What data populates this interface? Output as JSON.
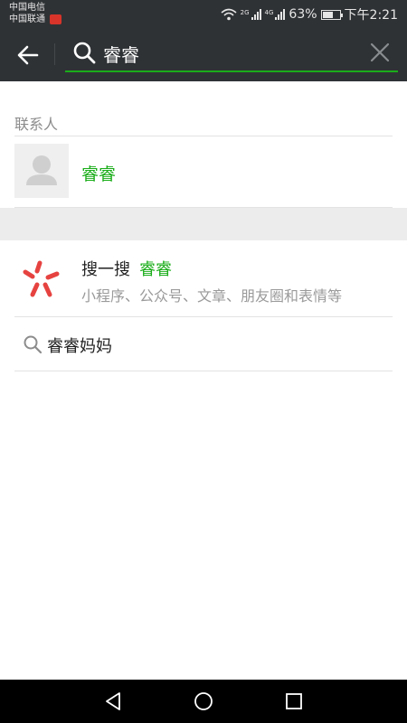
{
  "status_bar": {
    "carrier_1": "中国电信",
    "carrier_2": "中国联通",
    "carrier_badge_text": "头条",
    "signal_1_tag": "2G",
    "signal_2_tag": "4G",
    "battery_percent": "63%",
    "battery_level": 0.63,
    "time": "下午2:21"
  },
  "top_bar": {
    "back_icon": "arrow-left-icon",
    "search_icon": "search-icon",
    "search_query": "睿睿",
    "clear_icon": "close-icon"
  },
  "contacts_section": {
    "header": "联系人",
    "items": [
      {
        "name": "睿睿",
        "avatar": "default-person-avatar"
      }
    ]
  },
  "search_one_search": {
    "title": "搜一搜",
    "keyword": "睿睿",
    "description": "小程序、公众号、文章、朋友圈和表情等",
    "icon": "sousuo-logo-icon",
    "accent_color": "#e64340"
  },
  "suggestions": [
    {
      "text": "睿睿妈妈",
      "icon": "search-icon"
    }
  ],
  "nav_bar": {
    "back": "triangle-back-icon",
    "home": "circle-home-icon",
    "recents": "square-recents-icon"
  },
  "colors": {
    "header_bg": "#2f3235",
    "accent_green": "#1aad19",
    "section_band": "#ececec"
  }
}
